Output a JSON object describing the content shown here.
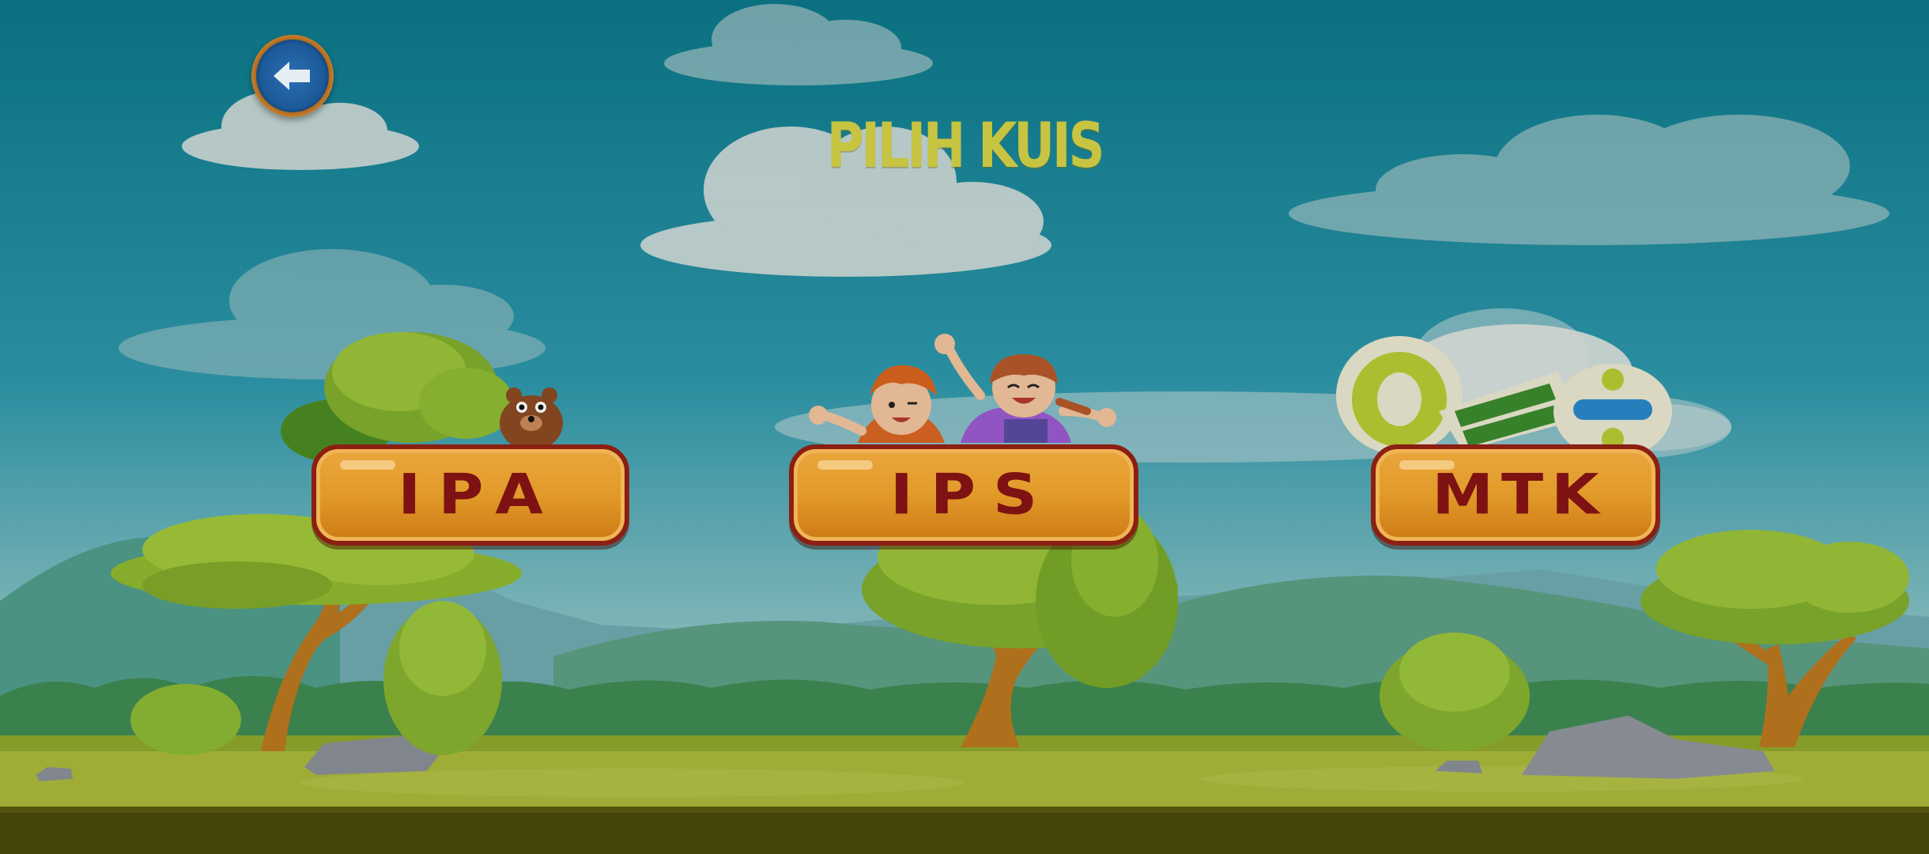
{
  "title": "PILIH KUIS",
  "back_button": {
    "icon": "arrow-left-icon"
  },
  "quizzes": [
    {
      "label": "IPA",
      "illustration": "tree-and-bear"
    },
    {
      "label": "IPS",
      "illustration": "waving-children"
    },
    {
      "label": "MTK",
      "illustration": "math-symbols"
    }
  ],
  "colors": {
    "sky": "#0d7a8b",
    "title": "#c7c441",
    "button_fill": "#e29b2a",
    "button_border": "#8b1f12",
    "button_text": "#7e1212",
    "grass": "#a9b83a"
  }
}
